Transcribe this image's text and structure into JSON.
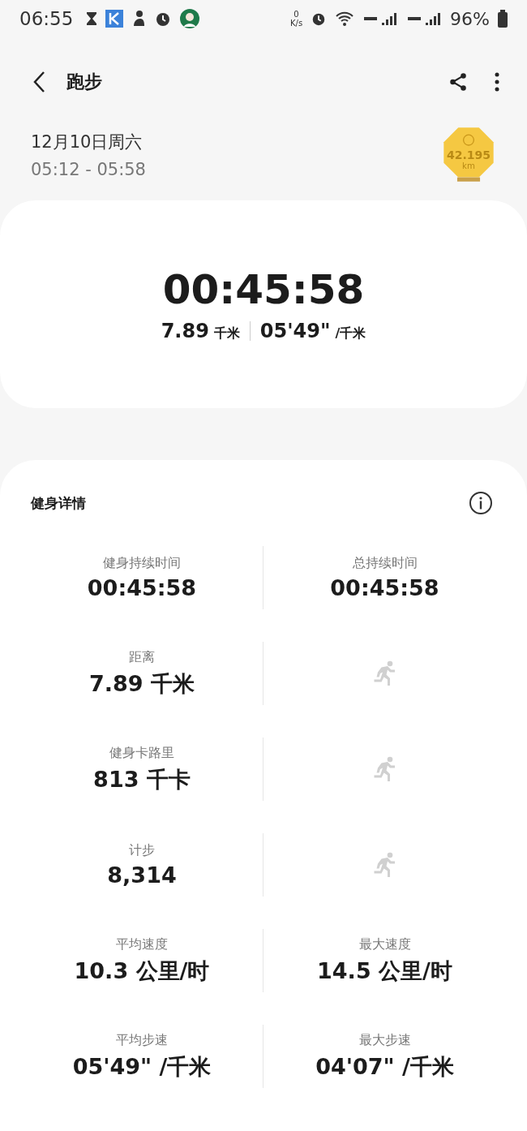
{
  "status_bar": {
    "time": "06:55",
    "net_speed_value": "0",
    "net_speed_unit": "K/s",
    "battery": "96%"
  },
  "header": {
    "title": "跑步"
  },
  "session": {
    "date": "12月10日周六",
    "time_range": "05:12 - 05:58",
    "medal": {
      "value": "42.195",
      "unit": "km"
    }
  },
  "summary": {
    "duration": "00:45:58",
    "distance": "7.89",
    "distance_unit": "千米",
    "pace": "05'49\"",
    "pace_unit": "/千米"
  },
  "details": {
    "title": "健身详情",
    "stats": [
      {
        "kind": "value",
        "label": "健身持续时间",
        "value": "00:45:58"
      },
      {
        "kind": "value",
        "label": "总持续时间",
        "value": "00:45:58"
      },
      {
        "kind": "value",
        "label": "距离",
        "value": "7.89 千米"
      },
      {
        "kind": "empty"
      },
      {
        "kind": "value",
        "label": "健身卡路里",
        "value": "813 千卡"
      },
      {
        "kind": "empty"
      },
      {
        "kind": "value",
        "label": "计步",
        "value": "8,314"
      },
      {
        "kind": "empty"
      },
      {
        "kind": "value",
        "label": "平均速度",
        "value": "10.3 公里/时"
      },
      {
        "kind": "value",
        "label": "最大速度",
        "value": "14.5 公里/时"
      },
      {
        "kind": "value",
        "label": "平均步速",
        "value": "05'49\" /千米"
      },
      {
        "kind": "value",
        "label": "最大步速",
        "value": "04'07\" /千米"
      }
    ]
  }
}
